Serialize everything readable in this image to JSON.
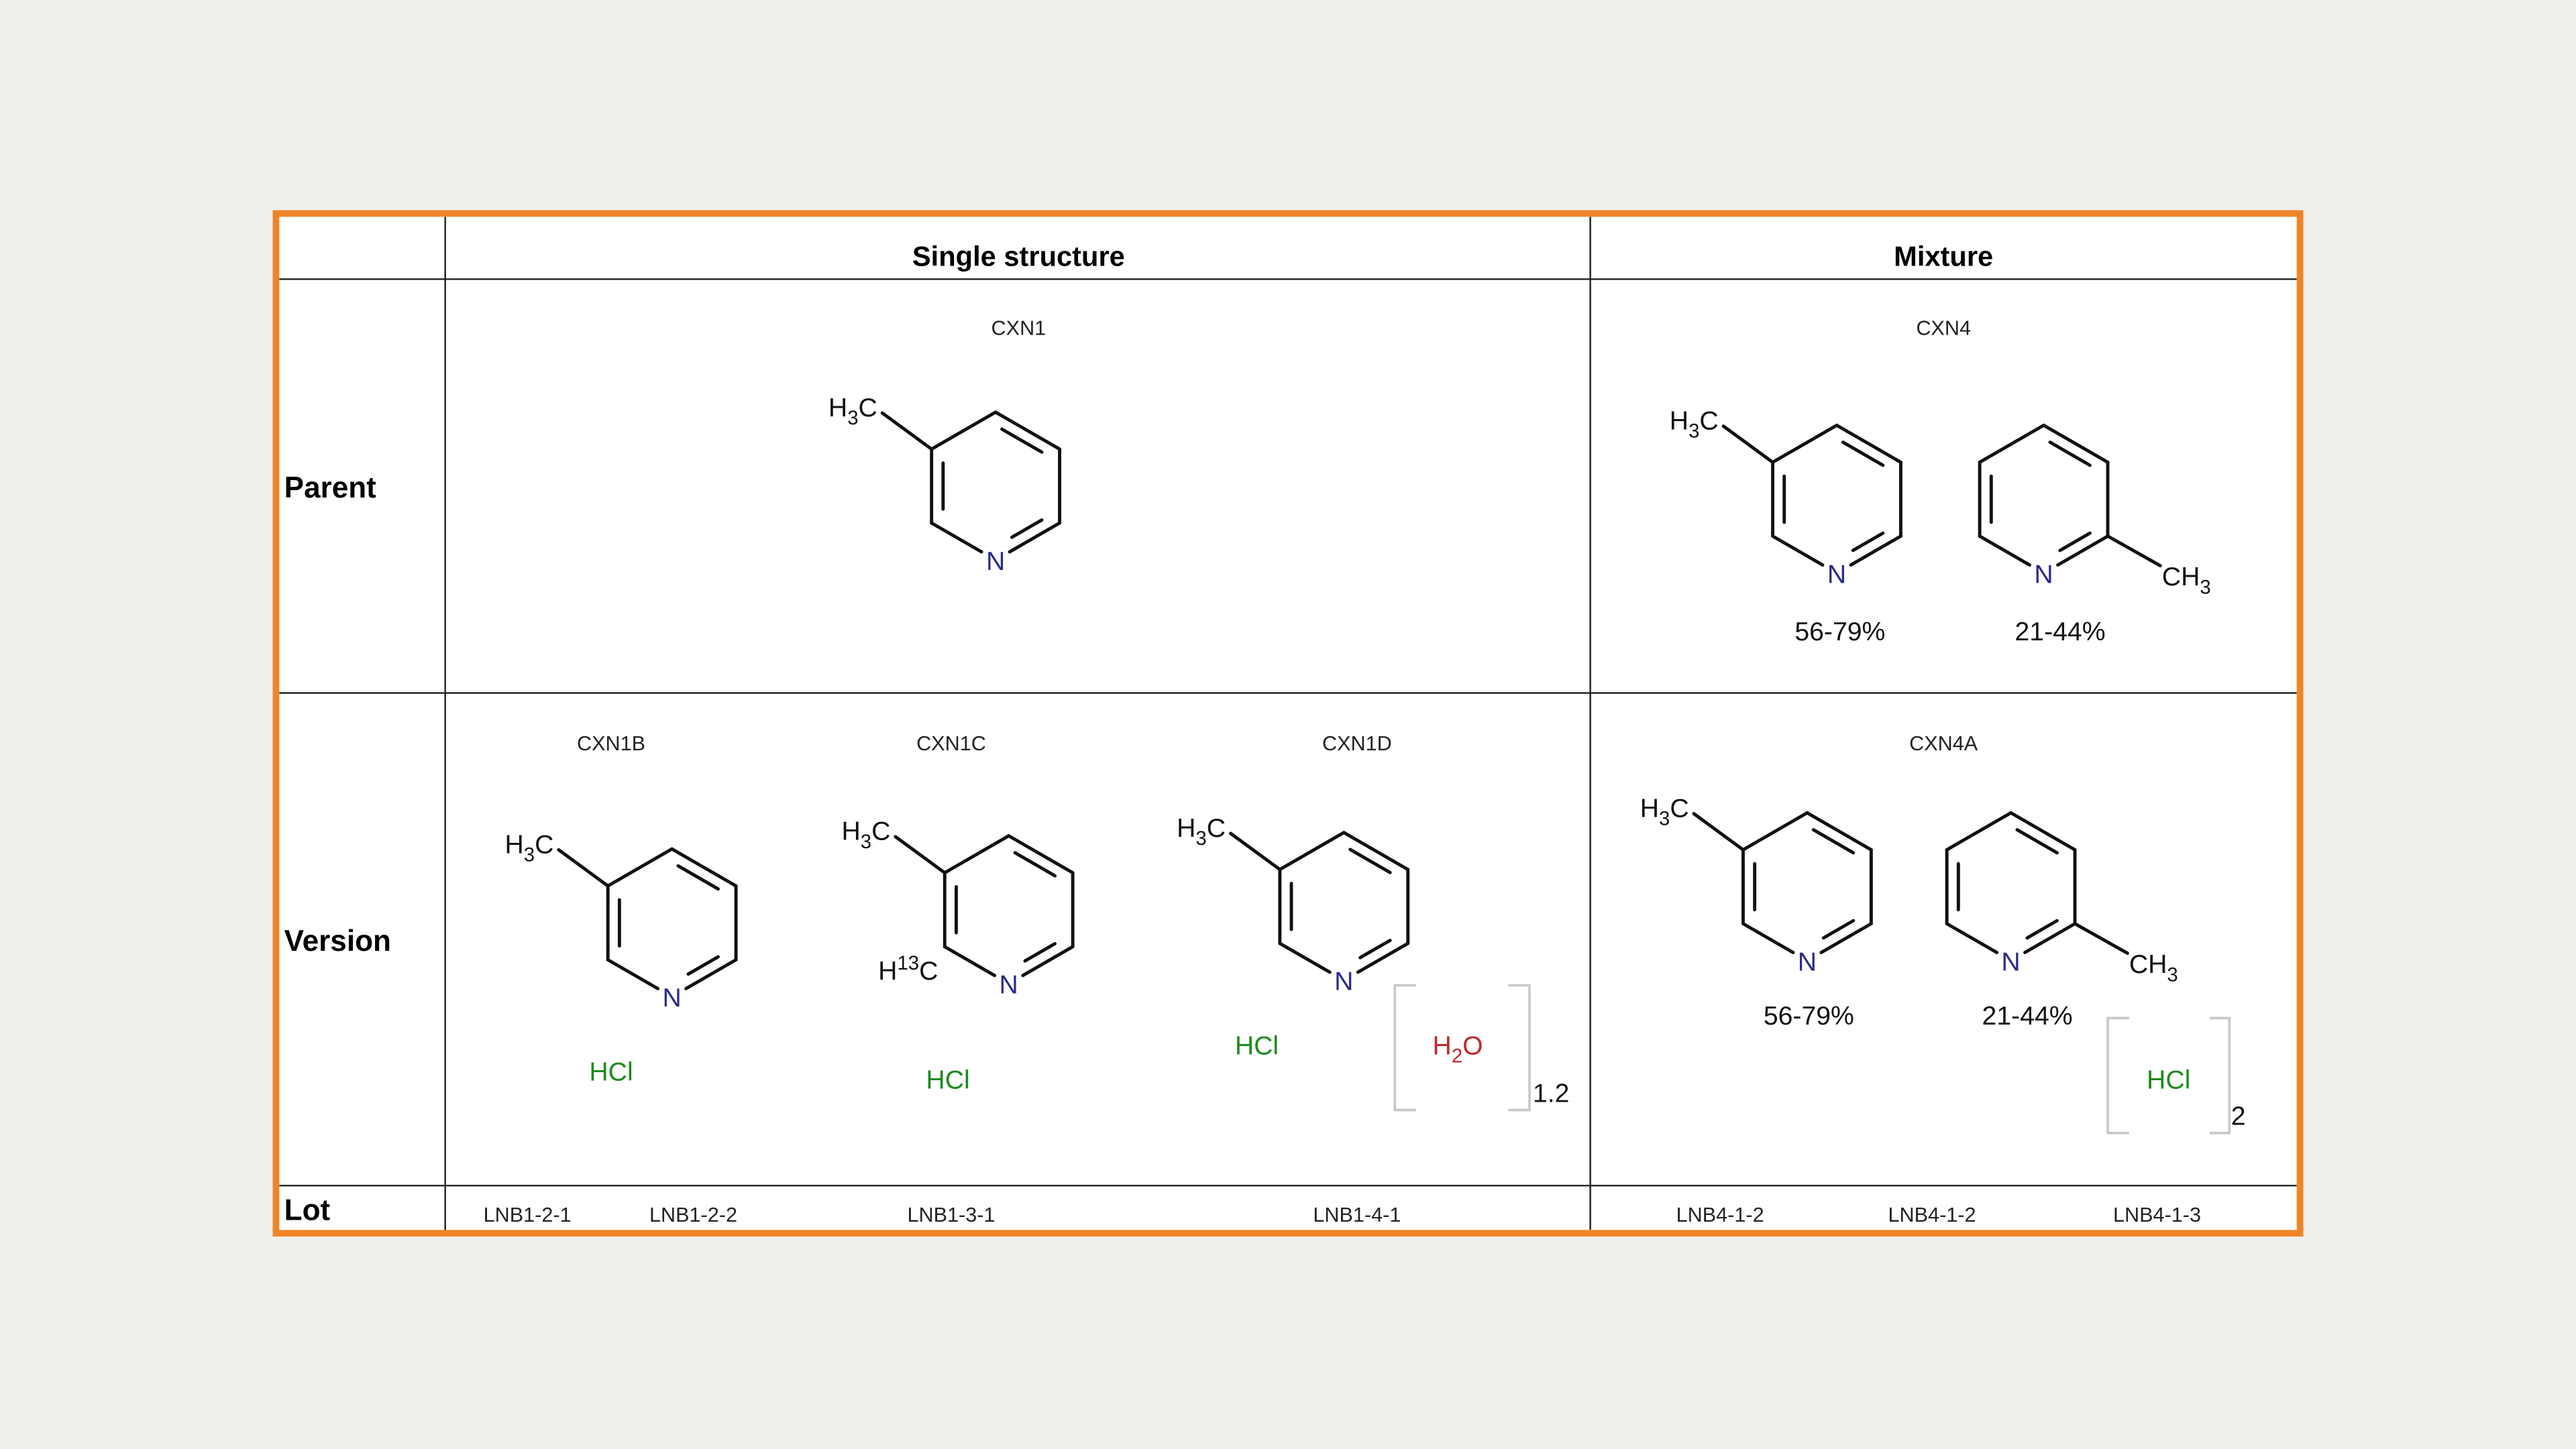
{
  "headers": {
    "single": "Single structure",
    "mixture": "Mixture"
  },
  "rows": {
    "parent": "Parent",
    "version": "Version",
    "lot": "Lot"
  },
  "parent": {
    "single": {
      "code": "CXN1"
    },
    "mixture": {
      "code": "CXN4",
      "pct_a": "56-79%",
      "pct_b": "21-44%"
    }
  },
  "versions": {
    "b": {
      "code": "CXN1B",
      "salt": "HCl"
    },
    "c": {
      "code": "CXN1C",
      "salt": "HCl",
      "isotope": "13"
    },
    "d": {
      "code": "CXN1D",
      "salt": "HCl",
      "solvent": "H2O",
      "solvent_count": "1.2"
    },
    "mix": {
      "code": "CXN4A",
      "pct_a": "56-79%",
      "pct_b": "21-44%",
      "salt": "HCl",
      "salt_count": "2"
    }
  },
  "atoms": {
    "methyl": "H3C",
    "methyl_right": "CH3",
    "nitrogen": "N",
    "hydrogen": "H",
    "carbon": "C"
  },
  "lots": [
    "LNB1-2-1",
    "LNB1-2-2",
    "LNB1-3-1",
    "LNB1-4-1",
    "LNB4-1-2",
    "LNB4-1-2",
    "LNB4-1-3"
  ],
  "colors": {
    "border": "#ef8427",
    "nitrogen": "#2c2a8a",
    "salt": "#1e8a1e",
    "water": "#c0282b"
  }
}
